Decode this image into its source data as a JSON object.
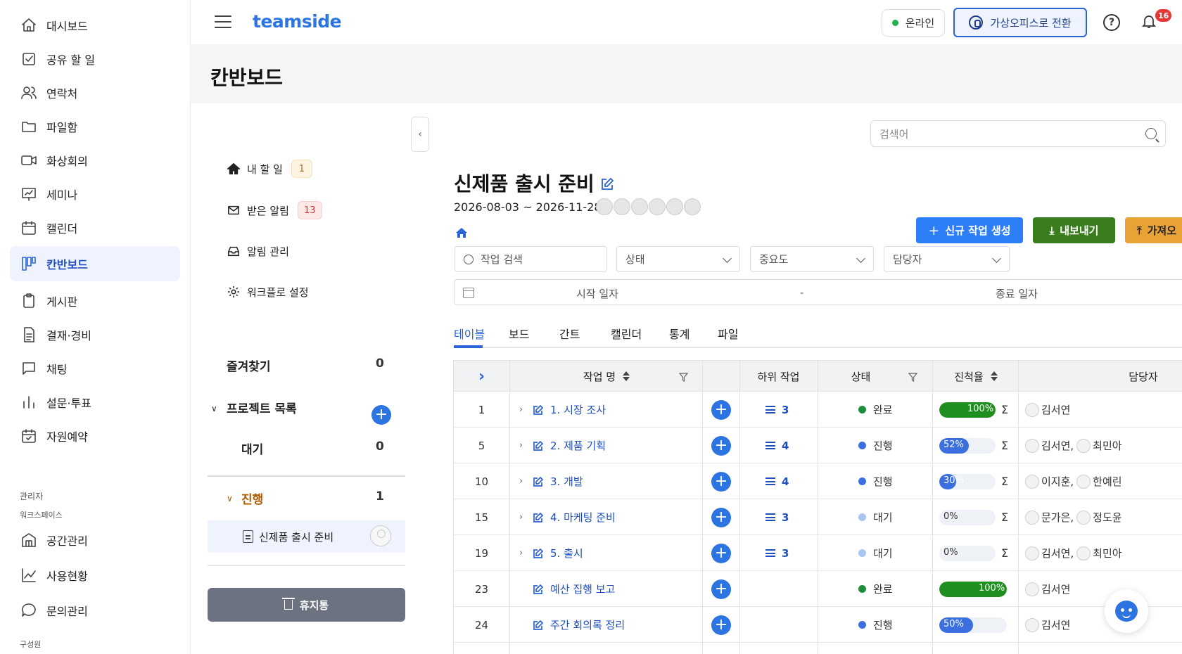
{
  "sidebar": {
    "items": [
      {
        "label": "대시보드",
        "icon": "home-icon"
      },
      {
        "label": "공유 할 일",
        "icon": "checkbox-icon"
      },
      {
        "label": "연락처",
        "icon": "contacts-icon"
      },
      {
        "label": "파일함",
        "icon": "folder-icon"
      },
      {
        "label": "화상회의",
        "icon": "video-icon"
      },
      {
        "label": "세미나",
        "icon": "presentation-icon"
      },
      {
        "label": "캘린더",
        "icon": "calendar-icon"
      },
      {
        "label": "칸반보드",
        "icon": "kanban-icon",
        "active": true
      },
      {
        "label": "게시판",
        "icon": "clipboard-icon"
      },
      {
        "label": "결재·경비",
        "icon": "document-icon"
      },
      {
        "label": "채팅",
        "icon": "chat-icon"
      },
      {
        "label": "설문·투표",
        "icon": "bar-chart-icon"
      },
      {
        "label": "자원예약",
        "icon": "calendar-check-icon"
      }
    ],
    "admin_caption": "관리자",
    "workspace_caption": "워크스페이스",
    "admin_items": [
      {
        "label": "공간관리",
        "icon": "building-icon"
      },
      {
        "label": "사용현황",
        "icon": "line-chart-icon"
      },
      {
        "label": "문의관리",
        "icon": "chat-bubble-icon"
      }
    ],
    "member_caption": "구성원"
  },
  "header": {
    "brand": "teamside",
    "status": "온라인",
    "virtual_office": "가상오피스로 전환",
    "help_symbol": "?",
    "notification_count": "16"
  },
  "page_title": "칸반보드",
  "panel": {
    "links": [
      {
        "label": "내 할 일",
        "badge": "1",
        "badge_style": "yellow",
        "icon": "home-icon"
      },
      {
        "label": "받은 알림",
        "badge": "13",
        "badge_style": "red",
        "icon": "mail-icon"
      },
      {
        "label": "알림 관리",
        "icon": "inbox-icon"
      },
      {
        "label": "워크플로 설정",
        "icon": "gear-icon"
      }
    ],
    "favorites_label": "즐겨찾기",
    "favorites_count": "0",
    "project_list_label": "프로젝트 목록",
    "waiting_label": "대기",
    "waiting_count": "0",
    "progress_label": "진행",
    "progress_count": "1",
    "project_item": "신제품 출시 준비",
    "trash_label": "휴지통",
    "collapse_symbol": "‹"
  },
  "main": {
    "search_placeholder": "검색어",
    "project_title": "신제품 출시 준비",
    "date_range": "2026-08-03 ~ 2026-11-28",
    "buttons": {
      "new_task": "신규 작업 생성",
      "export": "내보내기",
      "import": "가져오"
    },
    "filters": {
      "task_search": "작업 검색",
      "status": "상태",
      "priority": "중요도",
      "assignee": "담당자"
    },
    "date_filter": {
      "start": "시작 일자",
      "separator": "-",
      "end": "종료 일자"
    },
    "tabs": [
      "테이블",
      "보드",
      "간트",
      "캘린더",
      "통계",
      "파일"
    ],
    "active_tab": "테이블"
  },
  "table": {
    "headers": {
      "task_name": "작업 명",
      "subtasks": "하위 작업",
      "status": "상태",
      "progress": "진척율",
      "assignee": "담당자"
    },
    "expand_symbol": "›",
    "sigma": "Σ",
    "rows": [
      {
        "id": "1",
        "name": "1. 시장 조사",
        "has_children": true,
        "subtasks": "3",
        "status": "완료",
        "status_color": "#1e8e3e",
        "progress": 100,
        "progress_text": "100%",
        "progress_color": "#1e8e1e",
        "assignees": "김서연"
      },
      {
        "id": "5",
        "name": "2. 제품 기획",
        "has_children": true,
        "subtasks": "4",
        "status": "진행",
        "status_color": "#3b6fe0",
        "progress": 52,
        "progress_text": "52%",
        "progress_color": "#3b6fe0",
        "assignees": "김서연, ",
        "assignees2": "최민아"
      },
      {
        "id": "10",
        "name": "3. 개발",
        "has_children": true,
        "subtasks": "4",
        "status": "진행",
        "status_color": "#3b6fe0",
        "progress": 30,
        "progress_text": "30%",
        "progress_color": "#3b6fe0",
        "assignees": "이지훈, ",
        "assignees2": "한예린"
      },
      {
        "id": "15",
        "name": "4. 마케팅 준비",
        "has_children": true,
        "subtasks": "3",
        "status": "대기",
        "status_color": "#a9c6ee",
        "progress": 0,
        "progress_text": "0%",
        "progress_color": "#3b6fe0",
        "assignees": "문가은, ",
        "assignees2": "정도윤"
      },
      {
        "id": "19",
        "name": "5. 출시",
        "has_children": true,
        "subtasks": "3",
        "status": "대기",
        "status_color": "#a9c6ee",
        "progress": 0,
        "progress_text": "0%",
        "progress_color": "#3b6fe0",
        "assignees": "김서연, ",
        "assignees2": "최민아"
      },
      {
        "id": "23",
        "name": "예산 집행 보고",
        "has_children": false,
        "subtasks": "",
        "status": "완료",
        "status_color": "#1e8e3e",
        "progress": 100,
        "progress_text": "100%",
        "progress_color": "#1e8e1e",
        "assignees": "김서연"
      },
      {
        "id": "24",
        "name": "주간 회의록 정리",
        "has_children": false,
        "subtasks": "",
        "status": "진행",
        "status_color": "#3b6fe0",
        "progress": 50,
        "progress_text": "50%",
        "progress_color": "#3b6fe0",
        "assignees": "김서연"
      }
    ]
  }
}
